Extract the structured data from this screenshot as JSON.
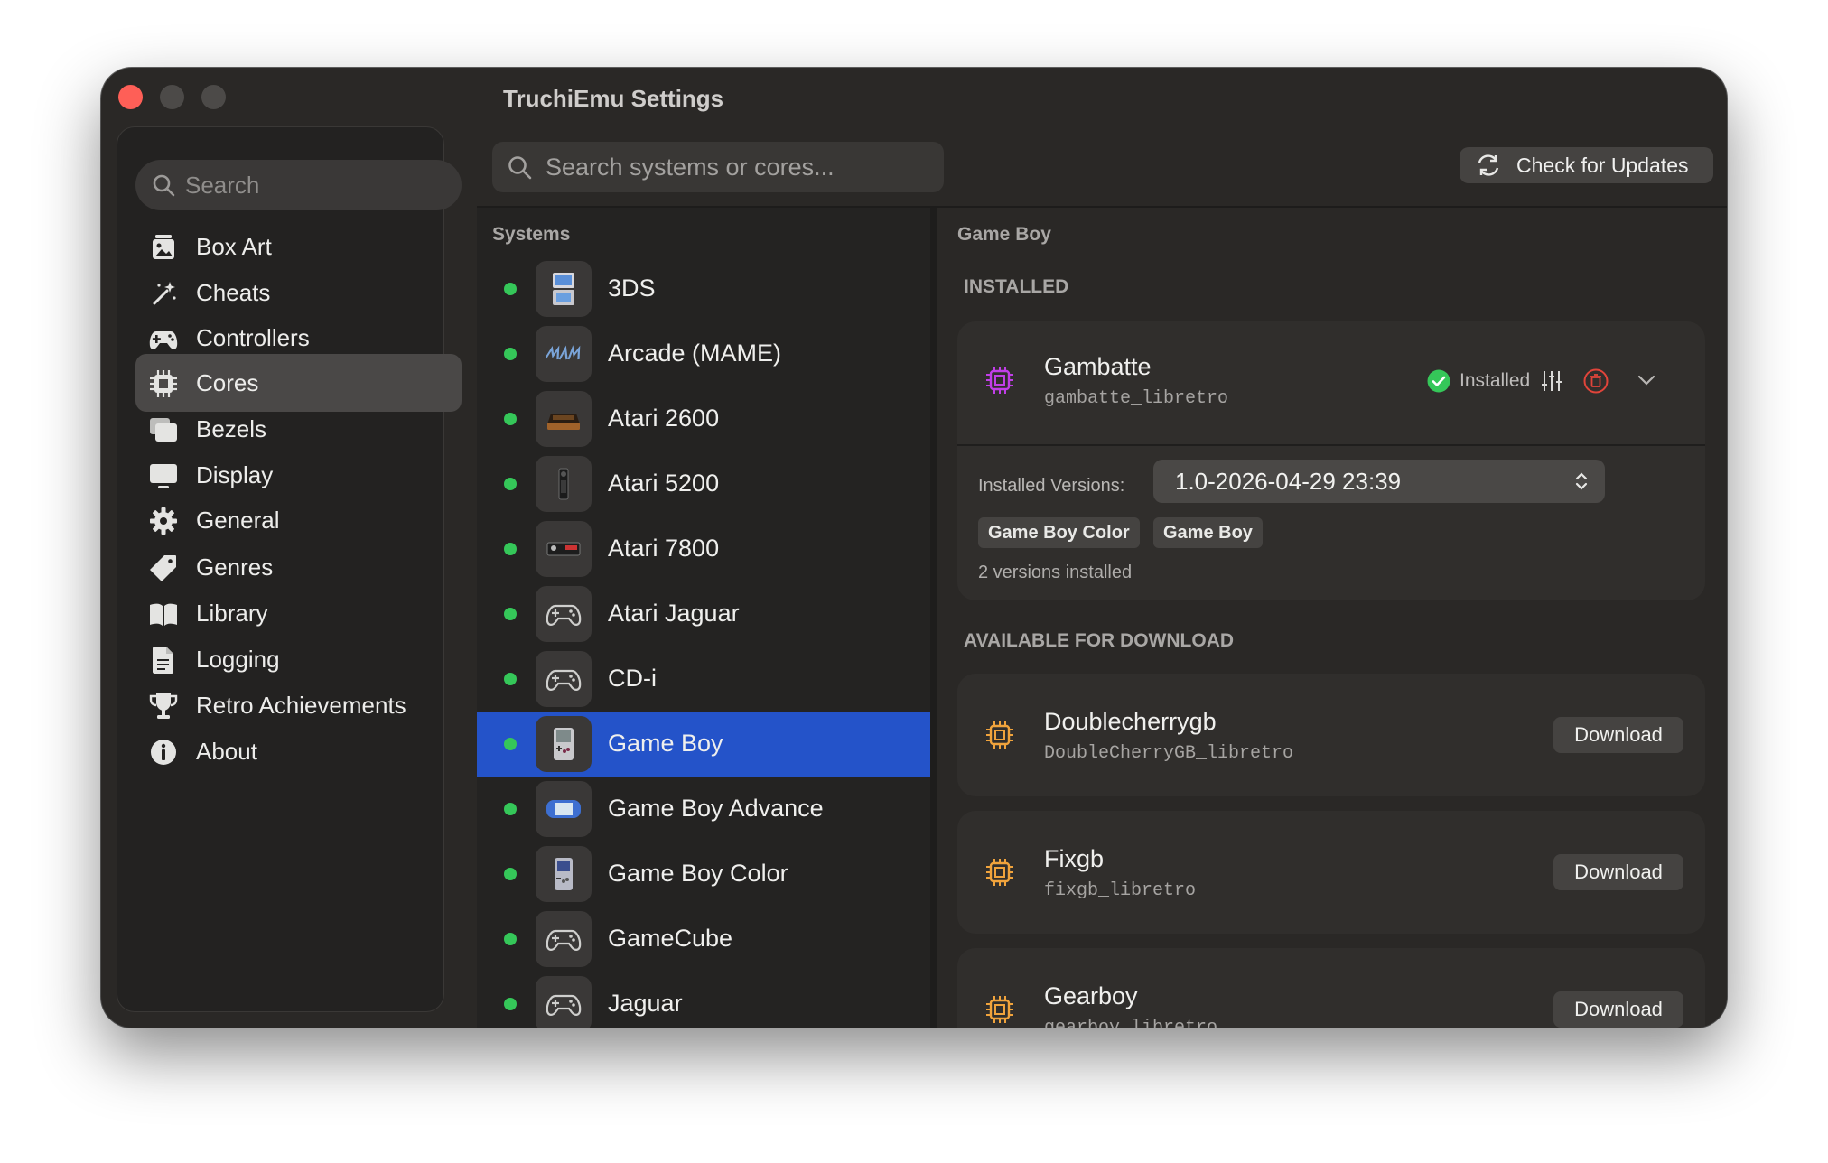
{
  "window": {
    "title": "TruchiEmu Settings"
  },
  "sidebar": {
    "search_placeholder": "Search",
    "items": [
      {
        "label": "Box Art",
        "icon": "box-art-icon"
      },
      {
        "label": "Cheats",
        "icon": "magic-wand-icon"
      },
      {
        "label": "Controllers",
        "icon": "gamepad-icon"
      },
      {
        "label": "Cores",
        "icon": "cpu-icon",
        "selected": true
      },
      {
        "label": "Bezels",
        "icon": "photo-stack-icon"
      },
      {
        "label": "Display",
        "icon": "display-icon"
      },
      {
        "label": "General",
        "icon": "gear-icon"
      },
      {
        "label": "Genres",
        "icon": "tag-icon"
      },
      {
        "label": "Library",
        "icon": "book-icon"
      },
      {
        "label": "Logging",
        "icon": "document-icon"
      },
      {
        "label": "Retro Achievements",
        "icon": "trophy-icon"
      },
      {
        "label": "About",
        "icon": "info-icon"
      }
    ]
  },
  "toolbar": {
    "search_placeholder": "Search systems or cores...",
    "check_updates_label": "Check for Updates"
  },
  "systems": {
    "header": "Systems",
    "items": [
      {
        "label": "3DS",
        "icon": "3ds-console-icon"
      },
      {
        "label": "Arcade (MAME)",
        "icon": "mame-logo-icon"
      },
      {
        "label": "Atari 2600",
        "icon": "atari-2600-console-icon"
      },
      {
        "label": "Atari 5200",
        "icon": "atari-5200-controller-icon"
      },
      {
        "label": "Atari 7800",
        "icon": "atari-7800-console-icon"
      },
      {
        "label": "Atari Jaguar",
        "icon": "gamepad-icon"
      },
      {
        "label": "CD-i",
        "icon": "gamepad-icon"
      },
      {
        "label": "Game Boy",
        "icon": "game-boy-icon",
        "selected": true
      },
      {
        "label": "Game Boy Advance",
        "icon": "game-boy-advance-icon"
      },
      {
        "label": "Game Boy Color",
        "icon": "game-boy-color-icon"
      },
      {
        "label": "GameCube",
        "icon": "gamepad-icon"
      },
      {
        "label": "Jaguar",
        "icon": "gamepad-icon"
      }
    ],
    "status_color": "#35c759"
  },
  "details": {
    "system_title": "Game Boy",
    "installed_header": "INSTALLED",
    "installed_core": {
      "name": "Gambatte",
      "id": "gambatte_libretro",
      "status_label": "Installed",
      "versions_label": "Installed Versions:",
      "selected_version": "1.0-2026-04-29 23:39",
      "tags": [
        "Game Boy Color",
        "Game Boy"
      ],
      "versions_count": "2 versions installed"
    },
    "available_header": "AVAILABLE FOR DOWNLOAD",
    "available_cores": [
      {
        "name": "Doublecherrygb",
        "id": "DoubleCherryGB_libretro",
        "button": "Download"
      },
      {
        "name": "Fixgb",
        "id": "fixgb_libretro",
        "button": "Download"
      },
      {
        "name": "Gearboy",
        "id": "gearboy_libretro",
        "button": "Download"
      }
    ]
  },
  "colors": {
    "accent": "#2453c9",
    "installed_chip": "#c13ee8",
    "available_chip": "#f0a33c",
    "delete": "#e0443a",
    "success": "#35c759"
  }
}
